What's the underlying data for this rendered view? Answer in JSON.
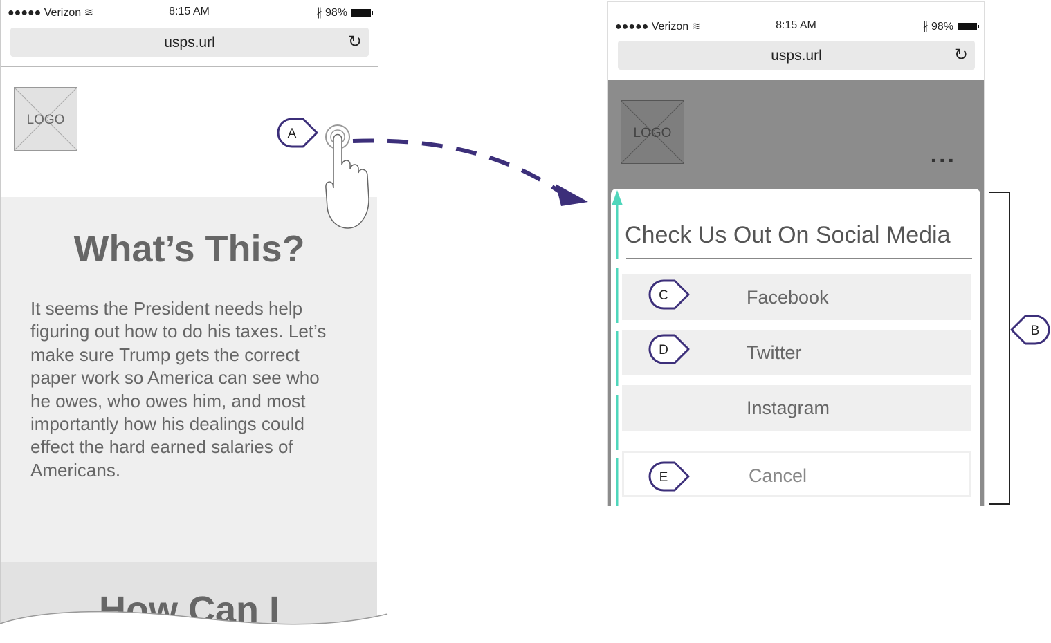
{
  "status_bar": {
    "carrier": "●●●●● Verizon",
    "wifi": "wifi-icon",
    "time": "8:15 AM",
    "bluetooth": "bluetooth-icon",
    "battery": "98%"
  },
  "browser": {
    "url": "usps.url",
    "reload_icon": "reload-icon"
  },
  "logo_text": "LOGO",
  "left_screen": {
    "title": "What’s This?",
    "body": "It seems the President needs help figuring out how to do his taxes. Let’s make sure Trump gets the correct paper work so America can see who he owes, who owes him, and most importantly how his dealings could effect the hard earned salaries of Americans.",
    "second_title": "How Can I"
  },
  "right_screen": {
    "menu_dots": "...",
    "sheet_title": "Check Us Out On Social Media",
    "options": [
      "Facebook",
      "Twitter",
      "Instagram"
    ],
    "cancel": "Cancel"
  },
  "annotations": {
    "a": "A",
    "b": "B",
    "c": "C",
    "d": "D",
    "e": "E"
  },
  "colors": {
    "annotation": "#3c2f7a",
    "scroll_indicator": "#4fd6bb"
  }
}
